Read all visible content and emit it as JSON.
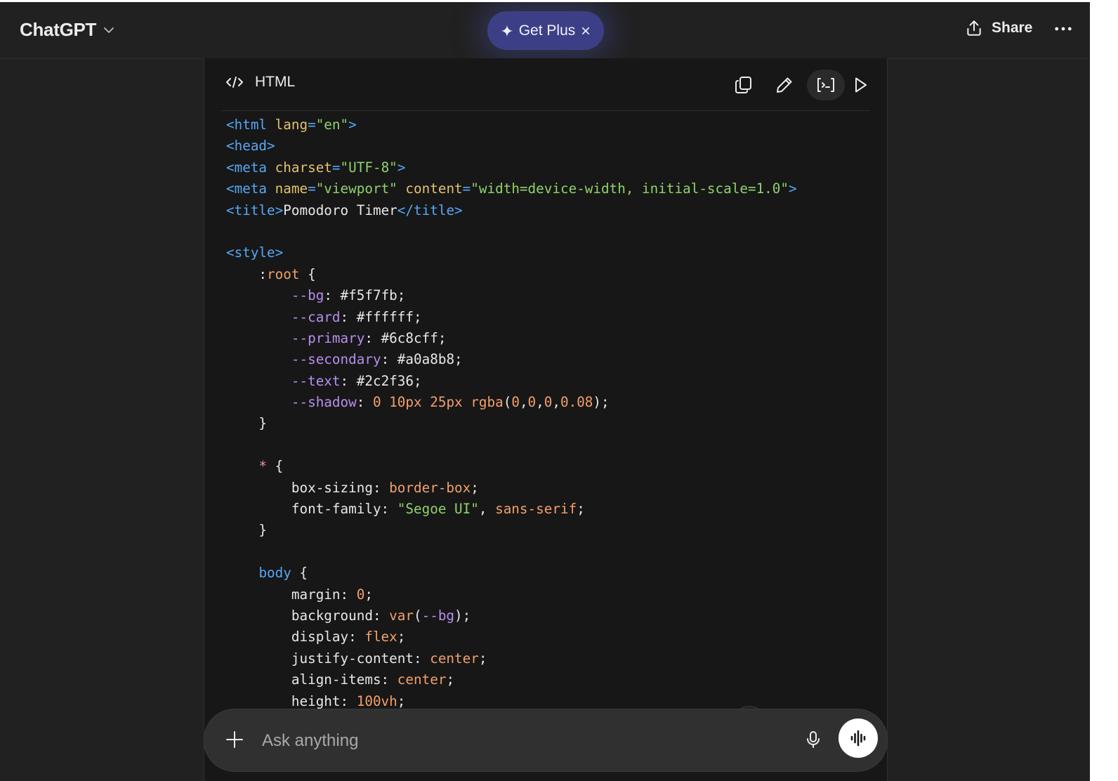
{
  "header": {
    "brand": "ChatGPT",
    "get_plus_label": "Get Plus",
    "share_label": "Share"
  },
  "code_block": {
    "language": "HTML",
    "lines": [
      [
        {
          "t": "tag",
          "v": "<html "
        },
        {
          "t": "attr",
          "v": "lang"
        },
        {
          "t": "tag",
          "v": "="
        },
        {
          "t": "str",
          "v": "\"en\""
        },
        {
          "t": "tag",
          "v": ">"
        }
      ],
      [
        {
          "t": "tag",
          "v": "<head>"
        }
      ],
      [
        {
          "t": "tag",
          "v": "<meta "
        },
        {
          "t": "attr",
          "v": "charset"
        },
        {
          "t": "tag",
          "v": "="
        },
        {
          "t": "str",
          "v": "\"UTF-8\""
        },
        {
          "t": "tag",
          "v": ">"
        }
      ],
      [
        {
          "t": "tag",
          "v": "<meta "
        },
        {
          "t": "attr",
          "v": "name"
        },
        {
          "t": "tag",
          "v": "="
        },
        {
          "t": "str",
          "v": "\"viewport\""
        },
        {
          "t": "plain",
          "v": " "
        },
        {
          "t": "attr",
          "v": "content"
        },
        {
          "t": "tag",
          "v": "="
        },
        {
          "t": "str",
          "v": "\"width=device-width, initial-scale=1.0\""
        },
        {
          "t": "tag",
          "v": ">"
        }
      ],
      [
        {
          "t": "tag",
          "v": "<title>"
        },
        {
          "t": "plain",
          "v": "Pomodoro Timer"
        },
        {
          "t": "tag",
          "v": "</title>"
        }
      ],
      [],
      [
        {
          "t": "tag",
          "v": "<style>"
        }
      ],
      [
        {
          "t": "plain",
          "v": "    :"
        },
        {
          "t": "kw",
          "v": "root"
        },
        {
          "t": "plain",
          "v": " {"
        }
      ],
      [
        {
          "t": "plain",
          "v": "        "
        },
        {
          "t": "var",
          "v": "--bg"
        },
        {
          "t": "plain",
          "v": ": #f5f7fb;"
        }
      ],
      [
        {
          "t": "plain",
          "v": "        "
        },
        {
          "t": "var",
          "v": "--card"
        },
        {
          "t": "plain",
          "v": ": #ffffff;"
        }
      ],
      [
        {
          "t": "plain",
          "v": "        "
        },
        {
          "t": "var",
          "v": "--primary"
        },
        {
          "t": "plain",
          "v": ": #6c8cff;"
        }
      ],
      [
        {
          "t": "plain",
          "v": "        "
        },
        {
          "t": "var",
          "v": "--secondary"
        },
        {
          "t": "plain",
          "v": ": #a0a8b8;"
        }
      ],
      [
        {
          "t": "plain",
          "v": "        "
        },
        {
          "t": "var",
          "v": "--text"
        },
        {
          "t": "plain",
          "v": ": #2c2f36;"
        }
      ],
      [
        {
          "t": "plain",
          "v": "        "
        },
        {
          "t": "var",
          "v": "--shadow"
        },
        {
          "t": "plain",
          "v": ": "
        },
        {
          "t": "num",
          "v": "0 10px 25px"
        },
        {
          "t": "plain",
          "v": " "
        },
        {
          "t": "kw",
          "v": "rgba"
        },
        {
          "t": "plain",
          "v": "("
        },
        {
          "t": "num",
          "v": "0"
        },
        {
          "t": "plain",
          "v": ","
        },
        {
          "t": "num",
          "v": "0"
        },
        {
          "t": "plain",
          "v": ","
        },
        {
          "t": "num",
          "v": "0"
        },
        {
          "t": "plain",
          "v": ","
        },
        {
          "t": "num",
          "v": "0.08"
        },
        {
          "t": "plain",
          "v": ");"
        }
      ],
      [
        {
          "t": "plain",
          "v": "    }"
        }
      ],
      [],
      [
        {
          "t": "plain",
          "v": "    "
        },
        {
          "t": "sel",
          "v": "*"
        },
        {
          "t": "plain",
          "v": " {"
        }
      ],
      [
        {
          "t": "plain",
          "v": "        box-sizing: "
        },
        {
          "t": "kw",
          "v": "border-box"
        },
        {
          "t": "plain",
          "v": ";"
        }
      ],
      [
        {
          "t": "plain",
          "v": "        font-family: "
        },
        {
          "t": "str",
          "v": "\"Segoe UI\""
        },
        {
          "t": "plain",
          "v": ", "
        },
        {
          "t": "kw",
          "v": "sans-serif"
        },
        {
          "t": "plain",
          "v": ";"
        }
      ],
      [
        {
          "t": "plain",
          "v": "    }"
        }
      ],
      [],
      [
        {
          "t": "plain",
          "v": "    "
        },
        {
          "t": "sel2",
          "v": "body"
        },
        {
          "t": "plain",
          "v": " {"
        }
      ],
      [
        {
          "t": "plain",
          "v": "        margin: "
        },
        {
          "t": "num",
          "v": "0"
        },
        {
          "t": "plain",
          "v": ";"
        }
      ],
      [
        {
          "t": "plain",
          "v": "        background: "
        },
        {
          "t": "kw",
          "v": "var"
        },
        {
          "t": "plain",
          "v": "("
        },
        {
          "t": "var",
          "v": "--bg"
        },
        {
          "t": "plain",
          "v": ");"
        }
      ],
      [
        {
          "t": "plain",
          "v": "        display: "
        },
        {
          "t": "kw",
          "v": "flex"
        },
        {
          "t": "plain",
          "v": ";"
        }
      ],
      [
        {
          "t": "plain",
          "v": "        justify-content: "
        },
        {
          "t": "kw",
          "v": "center"
        },
        {
          "t": "plain",
          "v": ";"
        }
      ],
      [
        {
          "t": "plain",
          "v": "        align-items: "
        },
        {
          "t": "kw",
          "v": "center"
        },
        {
          "t": "plain",
          "v": ";"
        }
      ],
      [
        {
          "t": "plain",
          "v": "        height: "
        },
        {
          "t": "num",
          "v": "100vh"
        },
        {
          "t": "plain",
          "v": ";"
        }
      ]
    ]
  },
  "composer": {
    "placeholder": "Ask anything"
  },
  "icons": {
    "brand_menu": "chevron-down-icon",
    "get_plus": "sparkle-icon",
    "get_plus_close": "close-icon",
    "share": "share-upload-icon",
    "more": "more-horizontal-icon",
    "code": "code-icon",
    "copy": "copy-icon",
    "edit": "pencil-icon",
    "toggle": "code-toggle-icon",
    "run": "play-icon",
    "scroll": "arrow-down-icon",
    "attach": "plus-icon",
    "mic": "microphone-icon",
    "voice": "voice-waveform-icon"
  },
  "colors": {
    "background": "#212121",
    "code_background": "#171717",
    "get_plus_background": "#3d3f86",
    "tag": "#56a7f5",
    "attribute": "#e3c26f",
    "string": "#8fd36b",
    "variable": "#b78ef0",
    "number": "#f3a06b"
  }
}
